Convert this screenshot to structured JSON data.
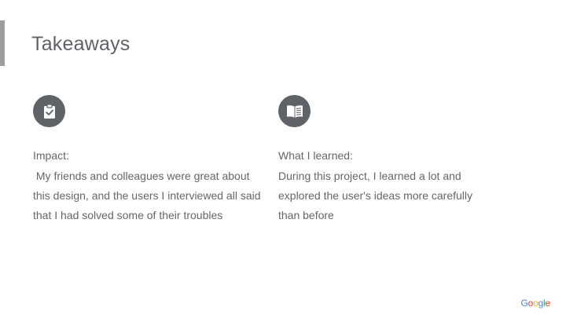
{
  "slide": {
    "title": "Takeaways"
  },
  "columns": [
    {
      "icon": "clipboard-check-icon",
      "heading": "Impact:",
      "body": " My friends and colleagues were great about this design, and the users I interviewed all said that I had solved some of their troubles"
    },
    {
      "icon": "open-book-icon",
      "heading": "What I learned:",
      "body": "During this project, I learned a lot and explored the user's ideas more carefully than before"
    }
  ],
  "logo": {
    "text": "Google",
    "colors": [
      "#4285F4",
      "#EA4335",
      "#FBBC05",
      "#4285F4",
      "#34A853",
      "#EA4335"
    ]
  },
  "colors": {
    "icon_background": "#5f6368",
    "accent_bar": "#9e9e9e",
    "text": "#666666"
  }
}
